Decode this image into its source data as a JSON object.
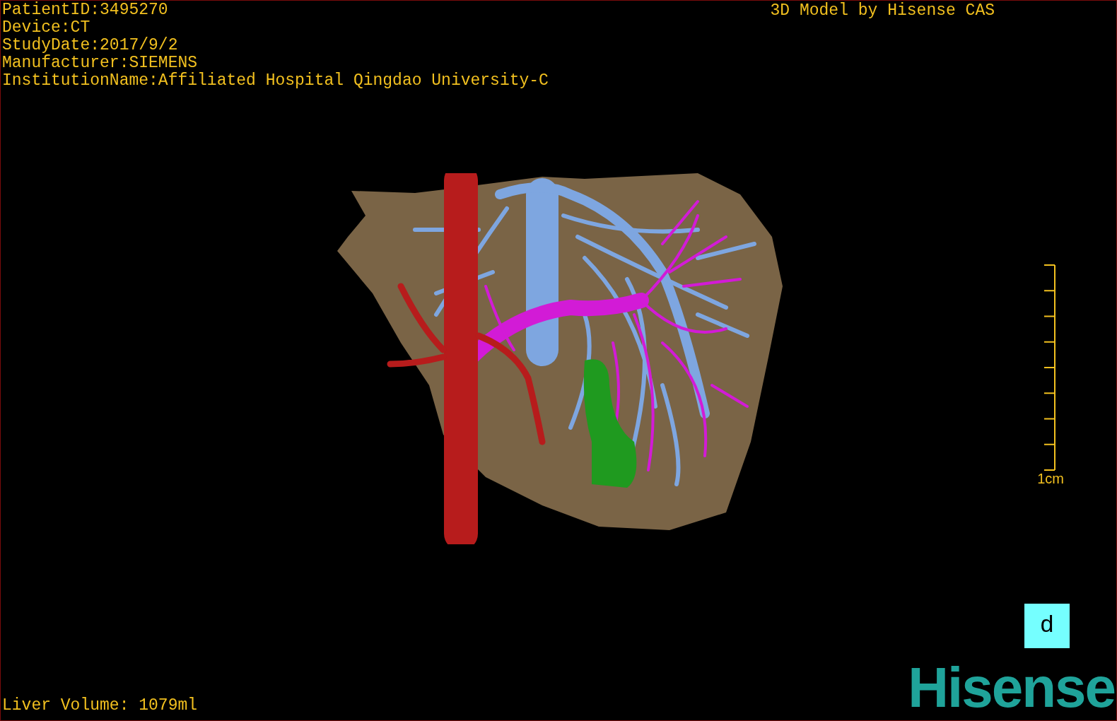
{
  "info_lines": [
    "PatientID:3495270",
    "Device:CT",
    "StudyDate:2017/9/2",
    "Manufacturer:SIEMENS",
    "InstitutionName:Affiliated Hospital Qingdao University-C"
  ],
  "title": "3D Model by Hisense CAS",
  "scale_bar": {
    "label": "1cm"
  },
  "orientation_marker": "d",
  "volume": "Liver Volume: 1079ml",
  "logo": "Hisense"
}
